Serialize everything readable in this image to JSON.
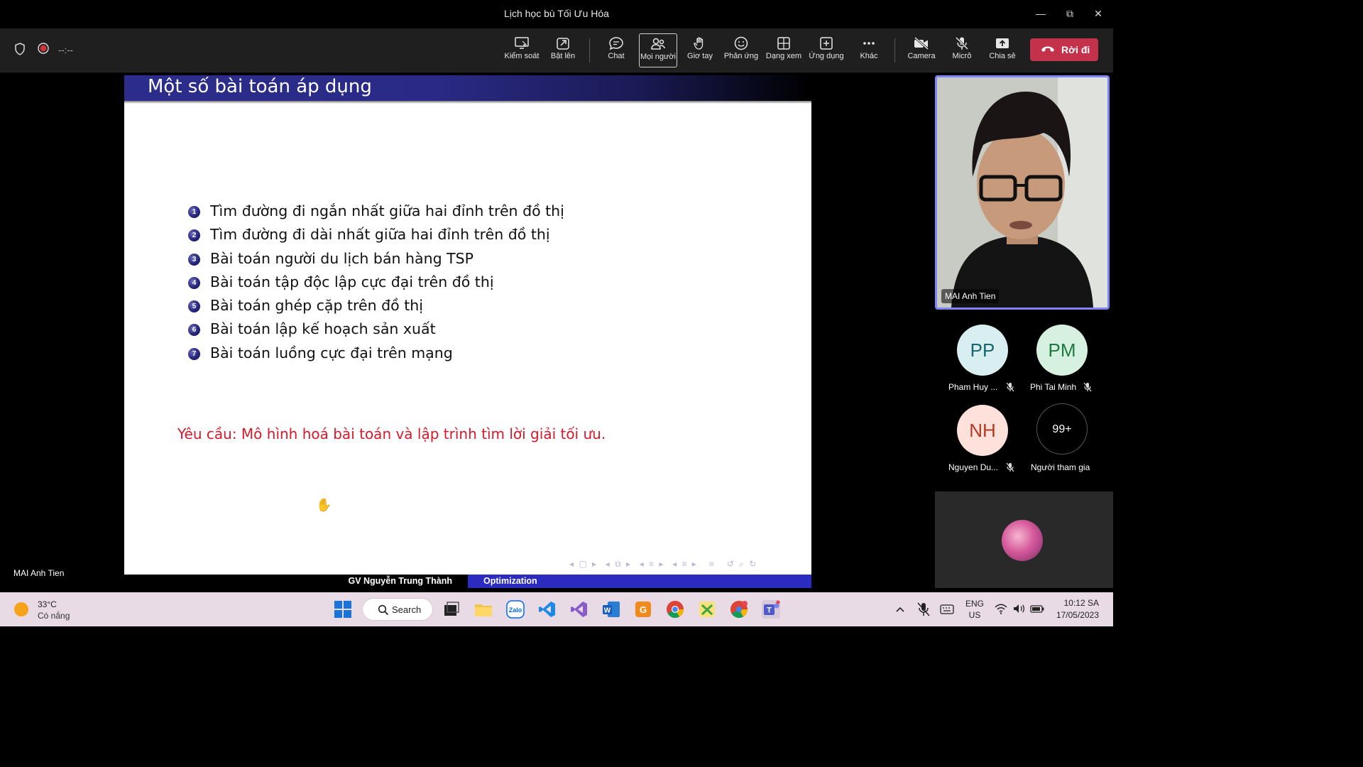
{
  "window": {
    "title": "Lịch học bù Tối Ưu Hóa"
  },
  "toolbar": {
    "timer": "--:--",
    "buttons": {
      "control": "Kiểm soát",
      "popout": "Bật lên",
      "chat": "Chat",
      "people": "Mọi người",
      "raise_hand": "Giơ tay",
      "react": "Phản ứng",
      "view": "Dạng xem",
      "apps": "Ứng dụng",
      "more": "Khác",
      "camera": "Camera",
      "mic": "Micrô",
      "share": "Chia sẻ"
    },
    "leave_label": "Rời đi",
    "leave_color": "#c4314b"
  },
  "stage": {
    "presenter_name": "MAI Anh Tien",
    "slide": {
      "heading": "Một số bài toán áp dụng",
      "items": [
        {
          "num": "1",
          "text": "Tìm đường đi ngắn nhất giữa hai đỉnh trên đồ thị"
        },
        {
          "num": "2",
          "text": "Tìm đường đi dài nhất giữa hai đỉnh trên đồ thị"
        },
        {
          "num": "3",
          "text": "Bài toán người du lịch bán hàng TSP"
        },
        {
          "num": "4",
          "text": "Bài toán tập độc lập cực đại trên đồ thị"
        },
        {
          "num": "5",
          "text": "Bài toán ghép cặp trên đồ thị"
        },
        {
          "num": "6",
          "text": "Bài toán lập kế hoạch sản xuất"
        },
        {
          "num": "7",
          "text": "Bài toán luồng cực đại trên mạng"
        }
      ],
      "requirement": "Yêu cầu: Mô hình hoá bài toán và lập trình tìm lời giải tối ưu.",
      "footer_left": "GV Nguyễn Trung Thành",
      "footer_right": "Optimization",
      "accent_color": "#2b2bbf",
      "requirement_color": "#d8192a"
    }
  },
  "participants": {
    "main_video_name": "MAI Anh Tien",
    "list": [
      {
        "initials": "PP",
        "name": "Pham Huy ...",
        "muted": true
      },
      {
        "initials": "PM",
        "name": "Phi Tai Minh",
        "muted": true
      },
      {
        "initials": "NH",
        "name": "Nguyen Du...",
        "muted": true
      },
      {
        "initials": "99+",
        "name": "Người tham gia",
        "muted": false
      }
    ]
  },
  "taskbar": {
    "weather_temp": "33°C",
    "weather_desc": "Có nắng",
    "search_label": "Search",
    "lang_top": "ENG",
    "lang_bottom": "US",
    "time": "10:12 SA",
    "date": "17/05/2023"
  }
}
